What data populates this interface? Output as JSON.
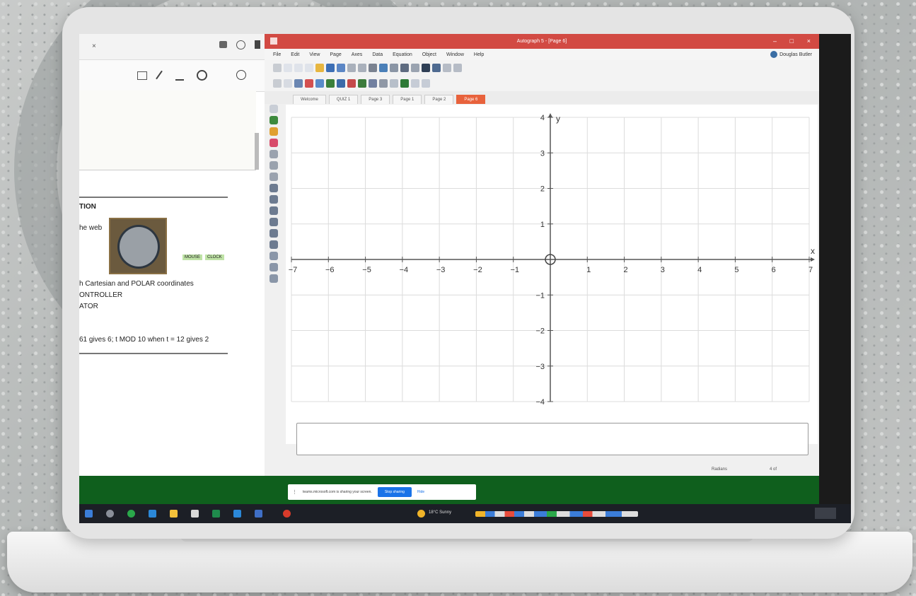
{
  "pdf": {
    "lines": [
      "TION",
      "he web",
      "MOUSE",
      "CLOCK",
      "h Cartesian and POLAR coordinates",
      "ONTROLLER",
      "ATOR",
      "61 gives 6; t MOD 10 when t = 12 gives 2"
    ]
  },
  "autograph": {
    "title": "Autograph 5 - [Page 6]",
    "user": "Douglas Butler",
    "menu": [
      "File",
      "Edit",
      "View",
      "Page",
      "Axes",
      "Data",
      "Equation",
      "Object",
      "Window",
      "Help"
    ],
    "tabs": [
      "Welcome",
      "QUIZ 1",
      "Page 3",
      "Page 1",
      "Page 2",
      "Page 6"
    ],
    "active_tab": "Page 6",
    "status_left": "Radians",
    "status_right": "4 of"
  },
  "share_bar": {
    "message": "teams.microsoft.com is sharing your screen.",
    "stop_label": "Stop sharing",
    "hide_label": "Hide"
  },
  "taskbar": {
    "weather": "18°C Sunny"
  },
  "chart_data": {
    "type": "scatter",
    "title": "",
    "xlabel": "x",
    "ylabel": "y",
    "xlim": [
      -7,
      7
    ],
    "ylim": [
      -4,
      4
    ],
    "x_ticks": [
      -7,
      -6,
      -5,
      -4,
      -3,
      -2,
      -1,
      1,
      2,
      3,
      4,
      5,
      6,
      7
    ],
    "y_ticks": [
      -4,
      -3,
      -2,
      -1,
      1,
      2,
      3,
      4
    ],
    "grid": true,
    "origin_marker": true,
    "series": []
  }
}
